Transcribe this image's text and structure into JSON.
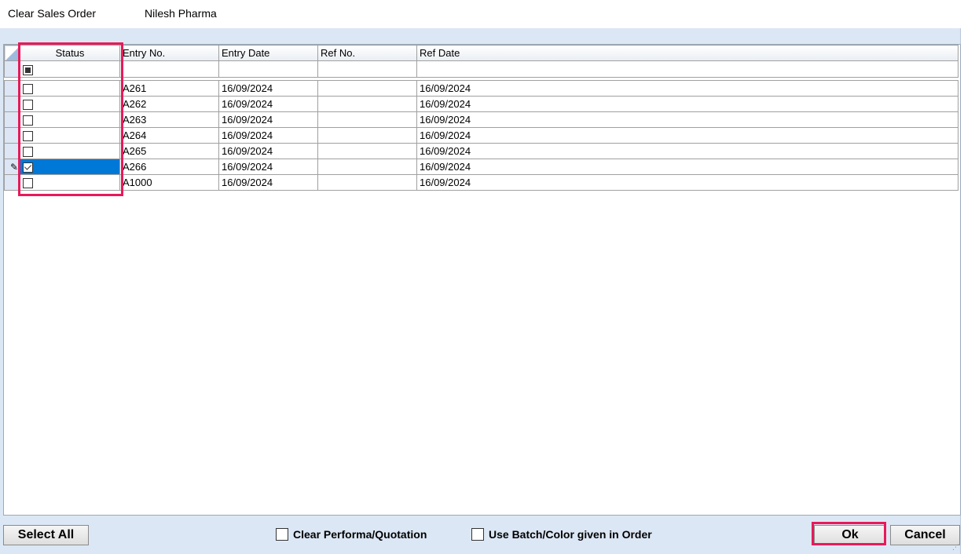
{
  "window": {
    "title": "Clear Sales Order",
    "party": "Nilesh Pharma"
  },
  "grid": {
    "columns": [
      "Status",
      "Entry No.",
      "Entry Date",
      "Ref No.",
      "Ref Date"
    ],
    "rows": [
      {
        "status": "unchecked",
        "entry_no": "A261",
        "entry_date": "16/09/2024",
        "ref_no": "",
        "ref_date": "16/09/2024"
      },
      {
        "status": "unchecked",
        "entry_no": "A262",
        "entry_date": "16/09/2024",
        "ref_no": "",
        "ref_date": "16/09/2024"
      },
      {
        "status": "unchecked",
        "entry_no": "A263",
        "entry_date": "16/09/2024",
        "ref_no": "",
        "ref_date": "16/09/2024"
      },
      {
        "status": "unchecked",
        "entry_no": "A264",
        "entry_date": "16/09/2024",
        "ref_no": "",
        "ref_date": "16/09/2024"
      },
      {
        "status": "unchecked",
        "entry_no": "A265",
        "entry_date": "16/09/2024",
        "ref_no": "",
        "ref_date": "16/09/2024"
      },
      {
        "status": "checked",
        "entry_no": "A266",
        "entry_date": "16/09/2024",
        "ref_no": "",
        "ref_date": "16/09/2024",
        "selected": true,
        "editing": true
      },
      {
        "status": "unchecked",
        "entry_no": "A1000",
        "entry_date": "16/09/2024",
        "ref_no": "",
        "ref_date": "16/09/2024"
      }
    ],
    "filter_status": "indeterminate",
    "selection_color": "#0078d7"
  },
  "footer": {
    "select_all_label": "Select All",
    "clear_performa_label": "Clear Performa/Quotation",
    "use_batch_label": "Use Batch/Color given in Order",
    "ok_label": "Ok",
    "cancel_label": "Cancel"
  },
  "colors": {
    "highlight": "#e8195a",
    "frame": "#dce7f5"
  }
}
